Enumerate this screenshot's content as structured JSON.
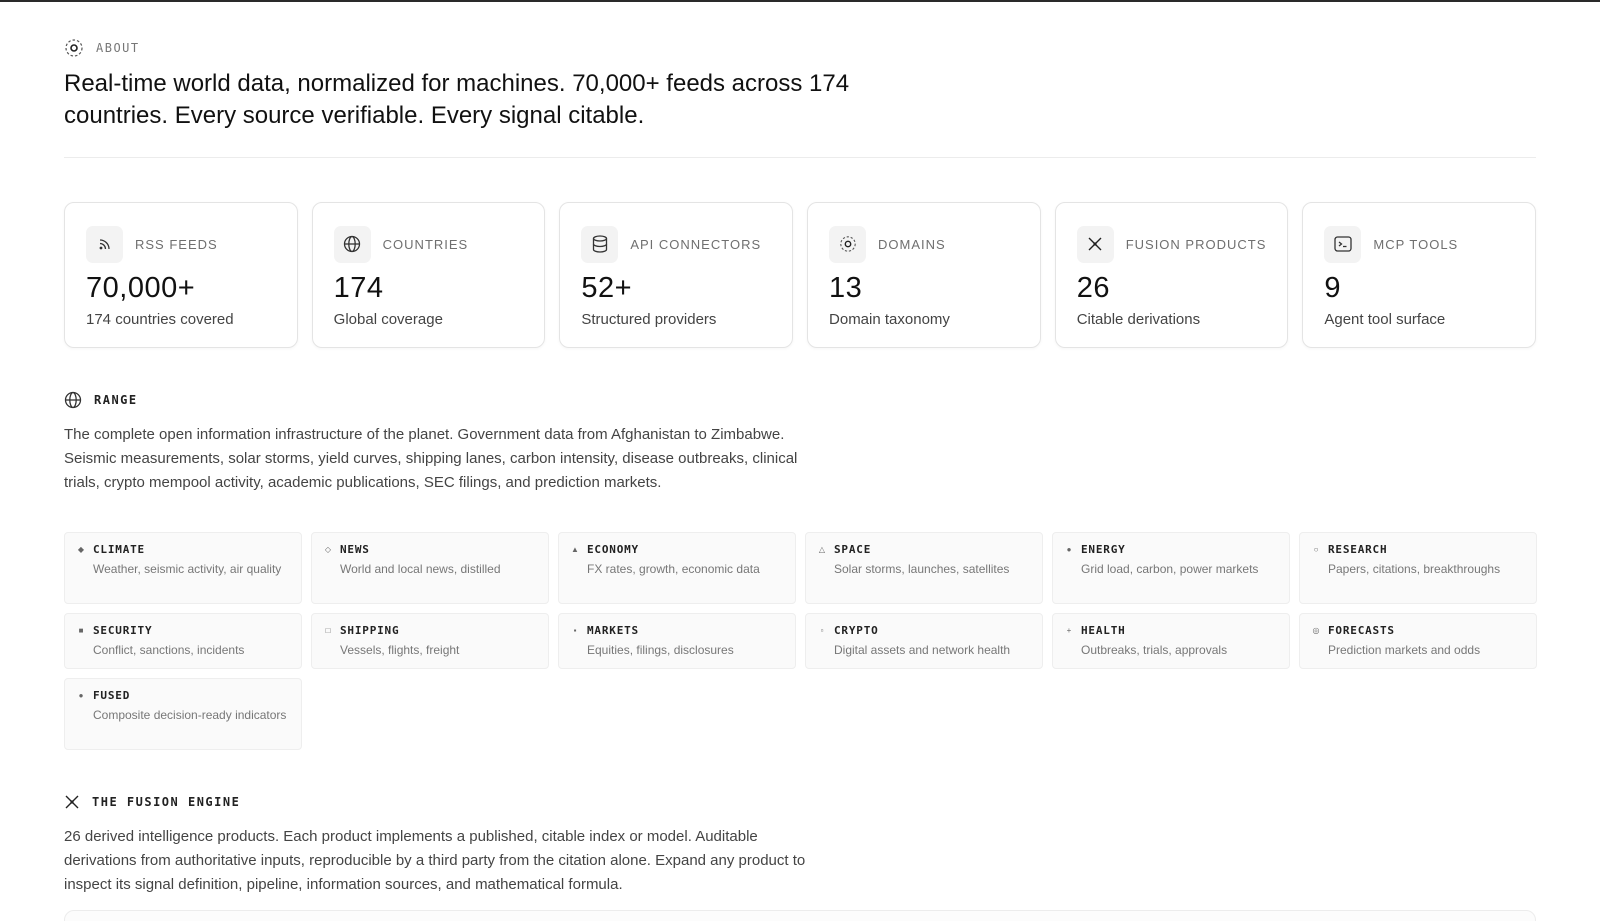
{
  "about": {
    "label": "ABOUT",
    "icon": "target-icon",
    "headline": "Real-time world data, normalized for machines. 70,000+ feeds across 174 countries. Every source verifiable. Every signal citable."
  },
  "stats": [
    {
      "icon": "rss-icon",
      "label": "RSS FEEDS",
      "value": "70,000+",
      "sub": "174 countries covered"
    },
    {
      "icon": "globe-icon",
      "label": "COUNTRIES",
      "value": "174",
      "sub": "Global coverage"
    },
    {
      "icon": "database-icon",
      "label": "API CONNECTORS",
      "value": "52+",
      "sub": "Structured providers"
    },
    {
      "icon": "target-icon",
      "label": "DOMAINS",
      "value": "13",
      "sub": "Domain taxonomy"
    },
    {
      "icon": "fusion-icon",
      "label": "FUSION PRODUCTS",
      "value": "26",
      "sub": "Citable derivations"
    },
    {
      "icon": "terminal-icon",
      "label": "MCP TOOLS",
      "value": "9",
      "sub": "Agent tool surface"
    }
  ],
  "range": {
    "label": "RANGE",
    "icon": "globe-icon",
    "text": "The complete open information infrastructure of the planet. Government data from Afghanistan to Zimbabwe. Seismic measurements, solar storms, yield curves, shipping lanes, carbon intensity, disease outbreaks, clinical trials, crypto mempool activity, academic publications, SEC filings, and prediction markets."
  },
  "domains": [
    {
      "glyph": "◆",
      "name": "CLIMATE",
      "desc": "Weather, seismic activity, air quality"
    },
    {
      "glyph": "◇",
      "name": "NEWS",
      "desc": "World and local news, distilled"
    },
    {
      "glyph": "▲",
      "name": "ECONOMY",
      "desc": "FX rates, growth, economic data"
    },
    {
      "glyph": "△",
      "name": "SPACE",
      "desc": "Solar storms, launches, satellites"
    },
    {
      "glyph": "●",
      "name": "ENERGY",
      "desc": "Grid load, carbon, power markets"
    },
    {
      "glyph": "○",
      "name": "RESEARCH",
      "desc": "Papers, citations, breakthroughs"
    },
    {
      "glyph": "■",
      "name": "SECURITY",
      "desc": "Conflict, sanctions, incidents"
    },
    {
      "glyph": "□",
      "name": "SHIPPING",
      "desc": "Vessels, flights, freight"
    },
    {
      "glyph": "▪",
      "name": "MARKETS",
      "desc": "Equities, filings, disclosures"
    },
    {
      "glyph": "▫",
      "name": "CRYPTO",
      "desc": "Digital assets and network health"
    },
    {
      "glyph": "+",
      "name": "HEALTH",
      "desc": "Outbreaks, trials, approvals"
    },
    {
      "glyph": "◎",
      "name": "FORECASTS",
      "desc": "Prediction markets and odds"
    },
    {
      "glyph": "●",
      "name": "FUSED",
      "desc": "Composite decision-ready indicators"
    }
  ],
  "fusion": {
    "label": "THE FUSION ENGINE",
    "icon": "fusion-icon",
    "text": "26 derived intelligence products. Each product implements a published, citable index or model. Auditable derivations from authoritative inputs, reproducible by a third party from the citation alone. Expand any product to inspect its signal definition, pipeline, information sources, and mathematical formula."
  }
}
